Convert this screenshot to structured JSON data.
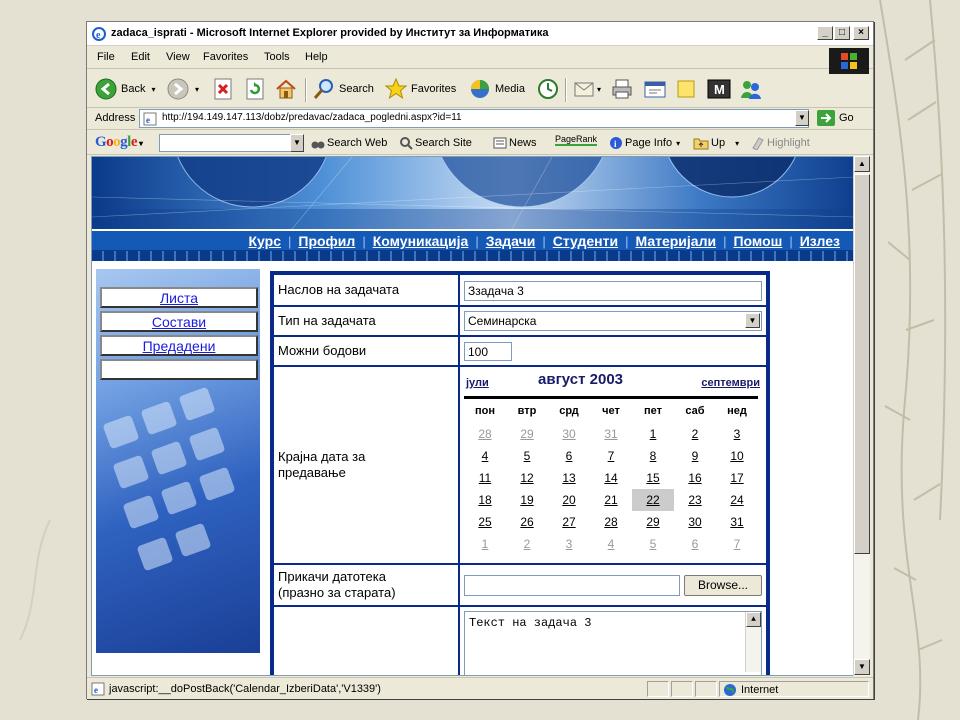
{
  "window": {
    "title": "zadaca_isprati - Microsoft Internet Explorer provided by Институт за Информатика"
  },
  "menu": [
    "File",
    "Edit",
    "View",
    "Favorites",
    "Tools",
    "Help"
  ],
  "toolbar": {
    "back": "Back",
    "search": "Search",
    "favorites": "Favorites",
    "media": "Media"
  },
  "address": {
    "label": "Address",
    "url": "http://194.149.147.113/dobz/predavac/zadaca_pogledni.aspx?id=11",
    "go": "Go"
  },
  "google": {
    "logo": "Google",
    "search_web": "Search Web",
    "search_site": "Search Site",
    "news": "News",
    "pagerank": "PageRank",
    "page_info": "Page Info",
    "up": "Up",
    "highlight": "Highlight"
  },
  "nav": [
    "Курс",
    "Профил",
    "Комуникација",
    "Задачи",
    "Студенти",
    "Материјали",
    "Помош",
    "Излез"
  ],
  "sidebar": [
    "Листа",
    "Состави",
    "Предадени",
    ""
  ],
  "form": {
    "title_label": "Наслов на задачата",
    "title_value": "Ззадача 3",
    "type_label": "Тип на задачата",
    "type_value": "Семинарска",
    "points_label": "Можни бодови",
    "points_value": "100",
    "deadline_label": "Крајна дата за предавање",
    "attach_label": "Прикачи датотека (празно за старата)",
    "browse": "Browse...",
    "text_value": "Текст на задача 3"
  },
  "calendar": {
    "prev": "јули",
    "month": "август 2003",
    "next": "септември",
    "dow": [
      "пон",
      "втр",
      "срд",
      "чет",
      "пет",
      "саб",
      "нед"
    ],
    "weeks": [
      [
        "28",
        "29",
        "30",
        "31",
        "1",
        "2",
        "3"
      ],
      [
        "4",
        "5",
        "6",
        "7",
        "8",
        "9",
        "10"
      ],
      [
        "11",
        "12",
        "13",
        "14",
        "15",
        "16",
        "17"
      ],
      [
        "18",
        "19",
        "20",
        "21",
        "22",
        "23",
        "24"
      ],
      [
        "25",
        "26",
        "27",
        "28",
        "29",
        "30",
        "31"
      ],
      [
        "1",
        "2",
        "3",
        "4",
        "5",
        "6",
        "7"
      ]
    ],
    "selected": "22"
  },
  "status": {
    "text": "javascript:__doPostBack('Calendar_IzberiData','V1339')",
    "zone": "Internet"
  }
}
